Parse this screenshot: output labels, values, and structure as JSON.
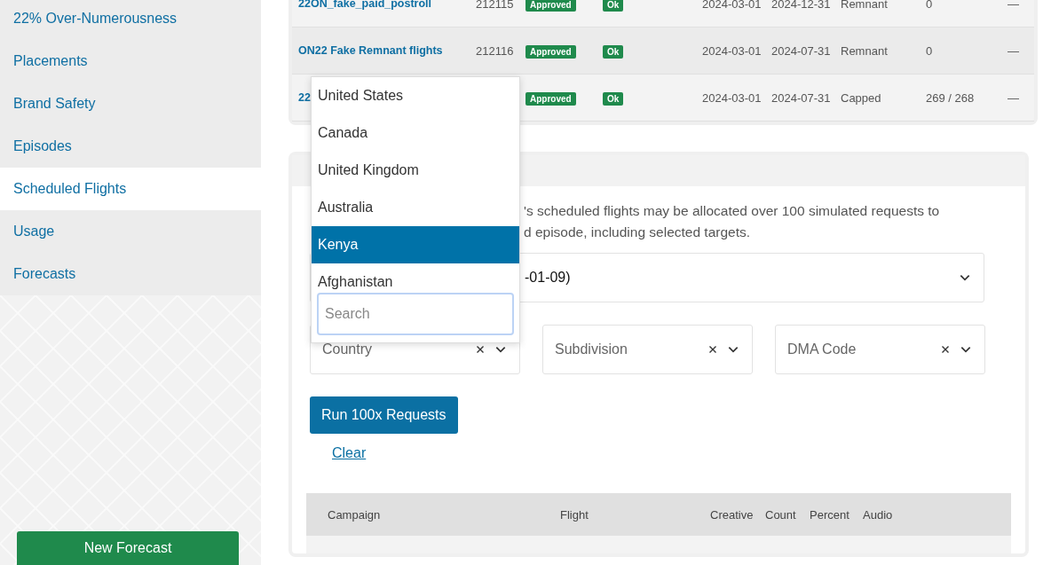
{
  "sidebar": {
    "items": [
      {
        "label": "22% Over-Numerousness",
        "selected": false
      },
      {
        "label": "Placements",
        "selected": false
      },
      {
        "label": "Brand Safety",
        "selected": false
      },
      {
        "label": "Episodes",
        "selected": false
      },
      {
        "label": "Scheduled Flights",
        "selected": true
      },
      {
        "label": "Usage",
        "selected": false
      },
      {
        "label": "Forecasts",
        "selected": false
      }
    ],
    "new_button": "New Forecast"
  },
  "flights_table": {
    "rows": [
      {
        "name": "22ON_fake_paid_postroll",
        "id": "212115",
        "status": "Approved",
        "health": "Ok",
        "start": "2024-03-01",
        "end": "2024-12-31",
        "type": "Remnant",
        "count": "0",
        "extra": "—"
      },
      {
        "name": "ON22 Fake Remnant flights",
        "id": "212116",
        "status": "Approved",
        "health": "Ok",
        "start": "2024-03-01",
        "end": "2024-07-31",
        "type": "Remnant",
        "count": "0",
        "extra": "—"
      },
      {
        "name": "22",
        "id": "",
        "status": "Approved",
        "health": "Ok",
        "start": "2024-03-01",
        "end": "2024-07-31",
        "type": "Capped",
        "count": "269 / 268",
        "extra": "—"
      }
    ]
  },
  "simulator": {
    "description_lines": [
      "'s scheduled flights may be allocated over 100 simulated requests to",
      "d episode, including selected targets."
    ],
    "episode_select": {
      "value": "-01-09)"
    },
    "filters": [
      {
        "placeholder": "Country"
      },
      {
        "placeholder": "Subdivision"
      },
      {
        "placeholder": "DMA Code"
      }
    ],
    "run_button": "Run 100x Requests",
    "clear_link": "Clear",
    "results_table": {
      "columns": [
        "Campaign",
        "Flight",
        "Creative",
        "Count",
        "Percent",
        "Audio"
      ]
    }
  },
  "country_dropdown": {
    "options": [
      {
        "label": "United States",
        "selected": false
      },
      {
        "label": "Canada",
        "selected": false
      },
      {
        "label": "United Kingdom",
        "selected": false
      },
      {
        "label": "Australia",
        "selected": false
      },
      {
        "label": "Kenya",
        "selected": true
      },
      {
        "label": "Afghanistan",
        "selected": false
      }
    ],
    "search": {
      "placeholder": "Search"
    }
  }
}
